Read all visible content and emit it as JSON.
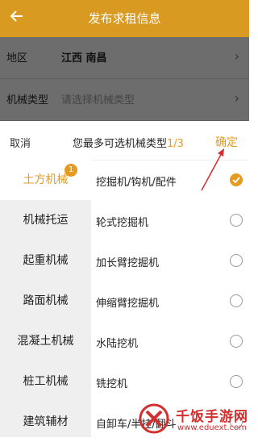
{
  "header": {
    "back_icon": "back-arrow-icon",
    "title": "发布求租信息"
  },
  "form": {
    "region_label": "地区",
    "region_value": "江西 南昌",
    "machine_type_label": "机械类型",
    "machine_type_placeholder": "请选择机械类型"
  },
  "picker": {
    "cancel_label": "取消",
    "hint_prefix": "您最多可选机械类型",
    "hint_count": "1/3",
    "confirm_label": "确定",
    "categories": [
      {
        "label": "土方机械",
        "badge": "1"
      },
      {
        "label": "机械托运"
      },
      {
        "label": "起重机械"
      },
      {
        "label": "路面机械"
      },
      {
        "label": "混凝土机械"
      },
      {
        "label": "桩工机械"
      },
      {
        "label": "建筑辅材"
      }
    ],
    "items": [
      {
        "label": "挖掘机/钩机/配件",
        "selected": true
      },
      {
        "label": "轮式挖掘机",
        "selected": false
      },
      {
        "label": "加长臂挖掘机",
        "selected": false
      },
      {
        "label": "伸缩臂挖掘机",
        "selected": false
      },
      {
        "label": "水陆挖机",
        "selected": false
      },
      {
        "label": "铣挖机",
        "selected": false
      },
      {
        "label": "自卸车/半挂/翻斗",
        "selected": false
      }
    ]
  },
  "watermark": {
    "name": "千饭手游网",
    "url": "www.eduext.com"
  },
  "colors": {
    "accent": "#e49b1f",
    "header": "#d99a22",
    "overlay": "#6d6d6d",
    "watermark": "#d32f2f"
  }
}
